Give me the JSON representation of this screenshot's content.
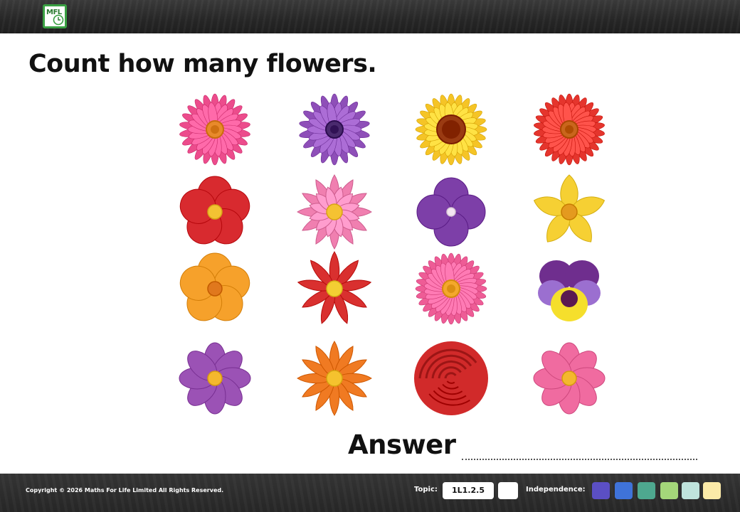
{
  "header": {
    "logo_text": "MFL"
  },
  "question": {
    "title": "Count how many flowers."
  },
  "flowers": [
    {
      "name": "pink-gerbera",
      "petal": "#ec4c8c",
      "center": "#e88a2b"
    },
    {
      "name": "purple-aster",
      "petal": "#8e4fb8",
      "center": "#4a2a6e"
    },
    {
      "name": "sunflower",
      "petal": "#f5c426",
      "center": "#9a3b12"
    },
    {
      "name": "red-gerbera",
      "petal": "#e5352d",
      "center": "#c9661c"
    },
    {
      "name": "red-hibiscus",
      "petal": "#d82a2f",
      "center": "#f3c233"
    },
    {
      "name": "pink-lotus",
      "petal": "#f07fb0",
      "center": "#f5c232"
    },
    {
      "name": "purple-violet",
      "petal": "#7d3fa8",
      "center": "#f4e6f2"
    },
    {
      "name": "yellow-lily",
      "petal": "#f6d033",
      "center": "#e49a1f"
    },
    {
      "name": "orange-nasturtium",
      "petal": "#f6a12b",
      "center": "#e0781d"
    },
    {
      "name": "red-dahlia",
      "petal": "#d9302f",
      "center": "#f3cf33"
    },
    {
      "name": "pink-chrysanthemum",
      "petal": "#ee5c96",
      "center": "#f4a82c"
    },
    {
      "name": "purple-pansy",
      "petal": "#6f2e8e",
      "center": "#f5df2c"
    },
    {
      "name": "purple-cosmos",
      "petal": "#9b52b5",
      "center": "#f4b82e"
    },
    {
      "name": "orange-daisy",
      "petal": "#f07a22",
      "center": "#f5c22e"
    },
    {
      "name": "red-rose",
      "petal": "#d12a2a",
      "center": "#9c1515"
    },
    {
      "name": "pink-cosmos",
      "petal": "#f06ba0",
      "center": "#f4b82e"
    }
  ],
  "answer": {
    "label": "Answer"
  },
  "footer": {
    "copyright": "Copyright © 2026 Maths For Life Limited All Rights Reserved.",
    "topic_label": "Topic:",
    "topic_code": "1L1.2.5",
    "independence_label": "Independence:",
    "independence_colors": [
      "#5b4fc4",
      "#3f73d9",
      "#4ea88f",
      "#a4d77a",
      "#bfe3dc",
      "#fbeaa8"
    ]
  },
  "colors": {
    "brand_green": "#3aa043",
    "bar_dark": "#2a2a2a"
  }
}
